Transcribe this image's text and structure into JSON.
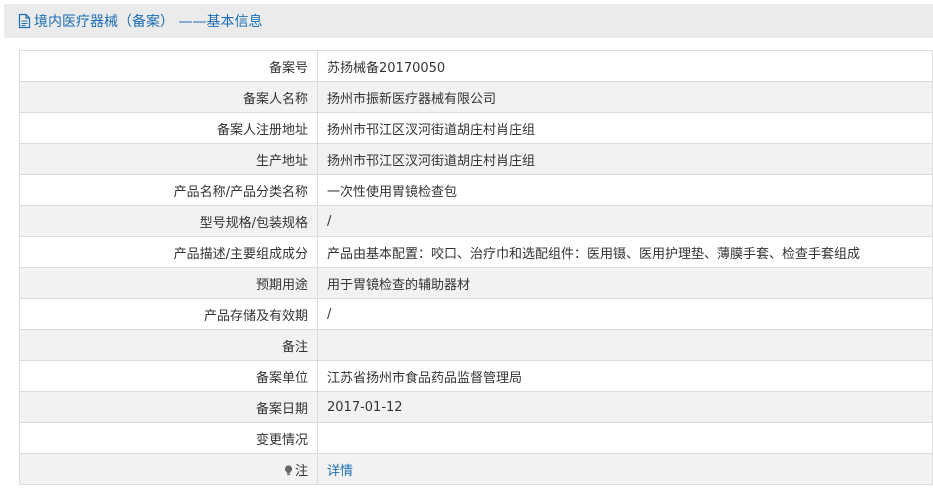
{
  "header": {
    "title": "境内医疗器械（备案） ——基本信息"
  },
  "rows": [
    {
      "label": "备案号",
      "value": "苏扬械备20170050"
    },
    {
      "label": "备案人名称",
      "value": "扬州市振新医疗器械有限公司"
    },
    {
      "label": "备案人注册地址",
      "value": "扬州市邗江区汊河街道胡庄村肖庄组"
    },
    {
      "label": "生产地址",
      "value": "扬州市邗江区汊河街道胡庄村肖庄组"
    },
    {
      "label": "产品名称/产品分类名称",
      "value": "一次性使用胃镜检查包"
    },
    {
      "label": "型号规格/包装规格",
      "value": "/"
    },
    {
      "label": "产品描述/主要组成成分",
      "value": "产品由基本配置：咬口、治疗巾和选配组件：医用镊、医用护理垫、薄膜手套、检查手套组成"
    },
    {
      "label": "预期用途",
      "value": "用于胃镜检查的辅助器材"
    },
    {
      "label": "产品存储及有效期",
      "value": "/"
    },
    {
      "label": "备注",
      "value": ""
    },
    {
      "label": "备案单位",
      "value": "江苏省扬州市食品药品监督管理局"
    },
    {
      "label": "备案日期",
      "value": "2017-01-12"
    },
    {
      "label": "变更情况",
      "value": ""
    }
  ],
  "note_row": {
    "label": "注",
    "link_text": "详情",
    "icon": "lightbulb-icon"
  },
  "colors": {
    "accent": "#1b6eb5",
    "header_bg": "#ebebeb",
    "alt_row_bg": "#f2f2f2",
    "border": "#dcdcdc"
  }
}
